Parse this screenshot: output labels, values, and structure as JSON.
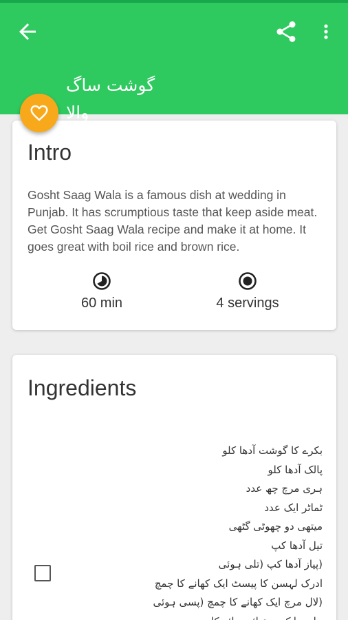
{
  "appbar": {
    "title": "گوشت ساگ والا",
    "back_icon": "arrow-back-icon",
    "share_icon": "share-icon",
    "more_icon": "more-vert-icon",
    "color": "#2fca5f"
  },
  "favorite": {
    "icon": "heart-outline-icon",
    "color": "#f8a91b"
  },
  "intro": {
    "heading": "Intro",
    "text": "Gosht Saag Wala is a famous dish at wedding in Punjab. It has scrumptious taste that keep aside meat. Get Gosht Saag Wala recipe and make it at home. It goes great with boil rice and brown rice.",
    "time": "60 min",
    "time_icon": "timer-icon",
    "servings": "4 servings",
    "servings_icon": "servings-icon"
  },
  "ingredients": {
    "heading": "Ingredients",
    "items": [
      "بکرے کا گوشت آدھا کلو",
      "پالک آدھا کلو",
      "ہری مرچ چھ عدد",
      "ٹماٹر ایک عدد",
      "میتھی دو چھوٹی گٹھی",
      "تیل آدھا کپ",
      "(پیاز آدھا کپ (تلی ہوئی",
      "ادرک لہسن کا پیسٹ ایک کھانے کا چمچ",
      "(لال مرچ ایک کھانے کا چمچ (پسی ہوئی",
      "ہلدی ایک چوتھائی چائے کا چمچ"
    ]
  }
}
